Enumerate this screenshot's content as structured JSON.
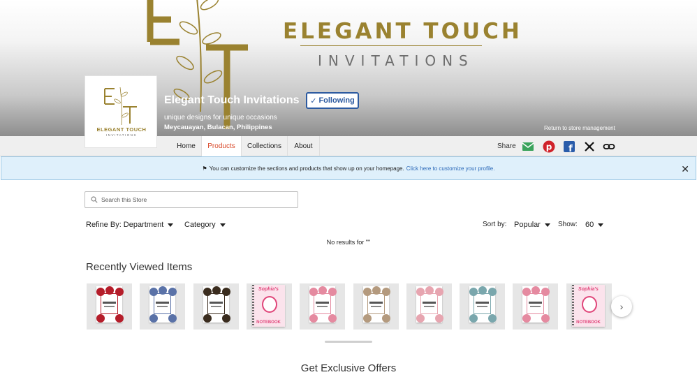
{
  "banner": {
    "brand_title": "ELEGANT TOUCH",
    "brand_subtitle": "INVITATIONS"
  },
  "store": {
    "name": "Elegant Touch Invitations",
    "follow_label": "Following",
    "tagline": "unique designs for unique occasions",
    "location": "Meycauayan, Bulacan, Philippines",
    "return_link": "Return to store management",
    "avatar_name": "ELEGANT TOUCH",
    "avatar_sub": "INVITATIONS"
  },
  "nav": {
    "tabs": [
      {
        "label": "Home",
        "active": false
      },
      {
        "label": "Products",
        "active": true
      },
      {
        "label": "Collections",
        "active": false
      },
      {
        "label": "About",
        "active": false
      }
    ],
    "share_label": "Share",
    "share_icons": [
      "email-icon",
      "pinterest-icon",
      "facebook-icon",
      "x-icon",
      "link-icon"
    ]
  },
  "infobar": {
    "message": "You can customize the sections and products that show up on your homepage.",
    "link": "Click here to customize your profile."
  },
  "search": {
    "placeholder": "Search this Store",
    "value": ""
  },
  "filters": {
    "refine": "Refine By: Department",
    "category": "Category",
    "sort_label": "Sort by:",
    "sort_value": "Popular",
    "show_label": "Show:",
    "show_value": "60"
  },
  "results": {
    "no_results": "No results for \"\""
  },
  "recently_viewed": {
    "title": "Recently Viewed Items",
    "items": [
      {
        "kind": "invitation",
        "accent": "#b51d2a"
      },
      {
        "kind": "invitation",
        "accent": "#5a72a8"
      },
      {
        "kind": "invitation",
        "accent": "#3a2c1e"
      },
      {
        "kind": "notebook",
        "accent": "#e0467a",
        "title": "Sophia's",
        "label": "NOTEBOOK"
      },
      {
        "kind": "invitation",
        "accent": "#e58aa0"
      },
      {
        "kind": "invitation",
        "accent": "#b49a7e"
      },
      {
        "kind": "invitation",
        "accent": "#e7a5b0"
      },
      {
        "kind": "invitation",
        "accent": "#7aa7ad"
      },
      {
        "kind": "invitation",
        "accent": "#e58aa0"
      },
      {
        "kind": "notebook",
        "accent": "#e0467a",
        "title": "Sophia's",
        "label": "NOTEBOOK"
      }
    ]
  },
  "offers": {
    "title": "Get Exclusive Offers"
  },
  "colors": {
    "brand_gold": "#9a8230",
    "active_tab": "#d9492a",
    "follow_blue": "#2c5aa0",
    "info_bg": "#dff0fb"
  }
}
